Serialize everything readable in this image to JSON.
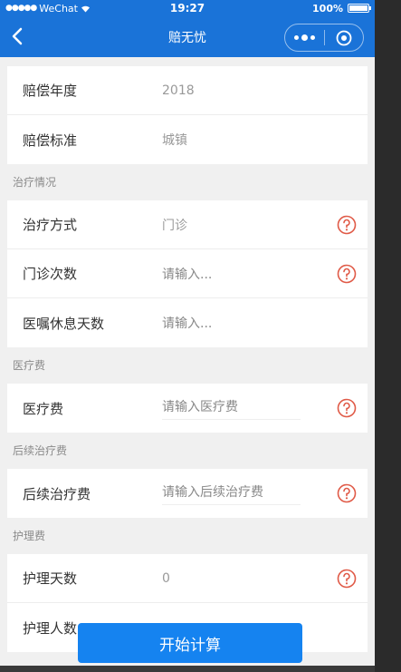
{
  "statusbar": {
    "carrier": "WeChat",
    "signal_dots": "●●●●●",
    "time": "19:27",
    "battery_text": "100%"
  },
  "navbar": {
    "title": "赔无忧"
  },
  "card1": {
    "rows": [
      {
        "label": "赔偿年度",
        "value": "2018"
      },
      {
        "label": "赔偿标准",
        "value": "城镇"
      }
    ]
  },
  "sections": [
    {
      "title": "治疗情况",
      "rows": [
        {
          "label": "治疗方式",
          "value": "门诊"
        },
        {
          "label": "门诊次数",
          "placeholder": "请输入..."
        },
        {
          "label": "医嘱休息天数",
          "placeholder": "请输入..."
        }
      ]
    },
    {
      "title": "医疗费",
      "rows": [
        {
          "label": "医疗费",
          "placeholder": "请输入医疗费"
        }
      ]
    },
    {
      "title": "后续治疗费",
      "rows": [
        {
          "label": "后续治疗费",
          "placeholder": "请输入后续治疗费"
        }
      ]
    },
    {
      "title": "护理费",
      "rows": [
        {
          "label": "护理天数",
          "value": "0"
        },
        {
          "label": "护理人数"
        }
      ]
    }
  ],
  "calculate_button": "开始计算",
  "colors": {
    "brand": "#1a73d8",
    "button": "#1583f0",
    "help_icon": "#e05a47"
  }
}
